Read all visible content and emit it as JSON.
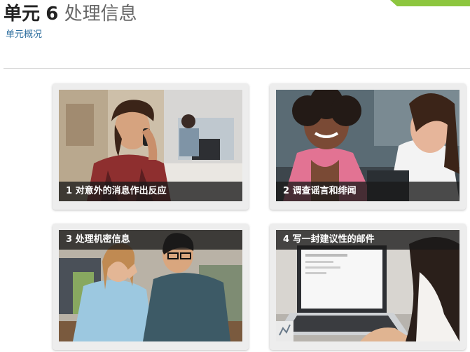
{
  "header": {
    "unit_word": "单元",
    "unit_number": "6",
    "unit_title": "处理信息",
    "overview_link": "单元概况"
  },
  "cards": [
    {
      "label": "1 对意外的消息作出反应"
    },
    {
      "label": "2 调查谣言和绯闻"
    },
    {
      "label": "3 处理机密信息"
    },
    {
      "label": "4 写一封建议性的邮件"
    }
  ],
  "colors": {
    "accent": "#8dc63f",
    "link": "#2f6f9f"
  }
}
